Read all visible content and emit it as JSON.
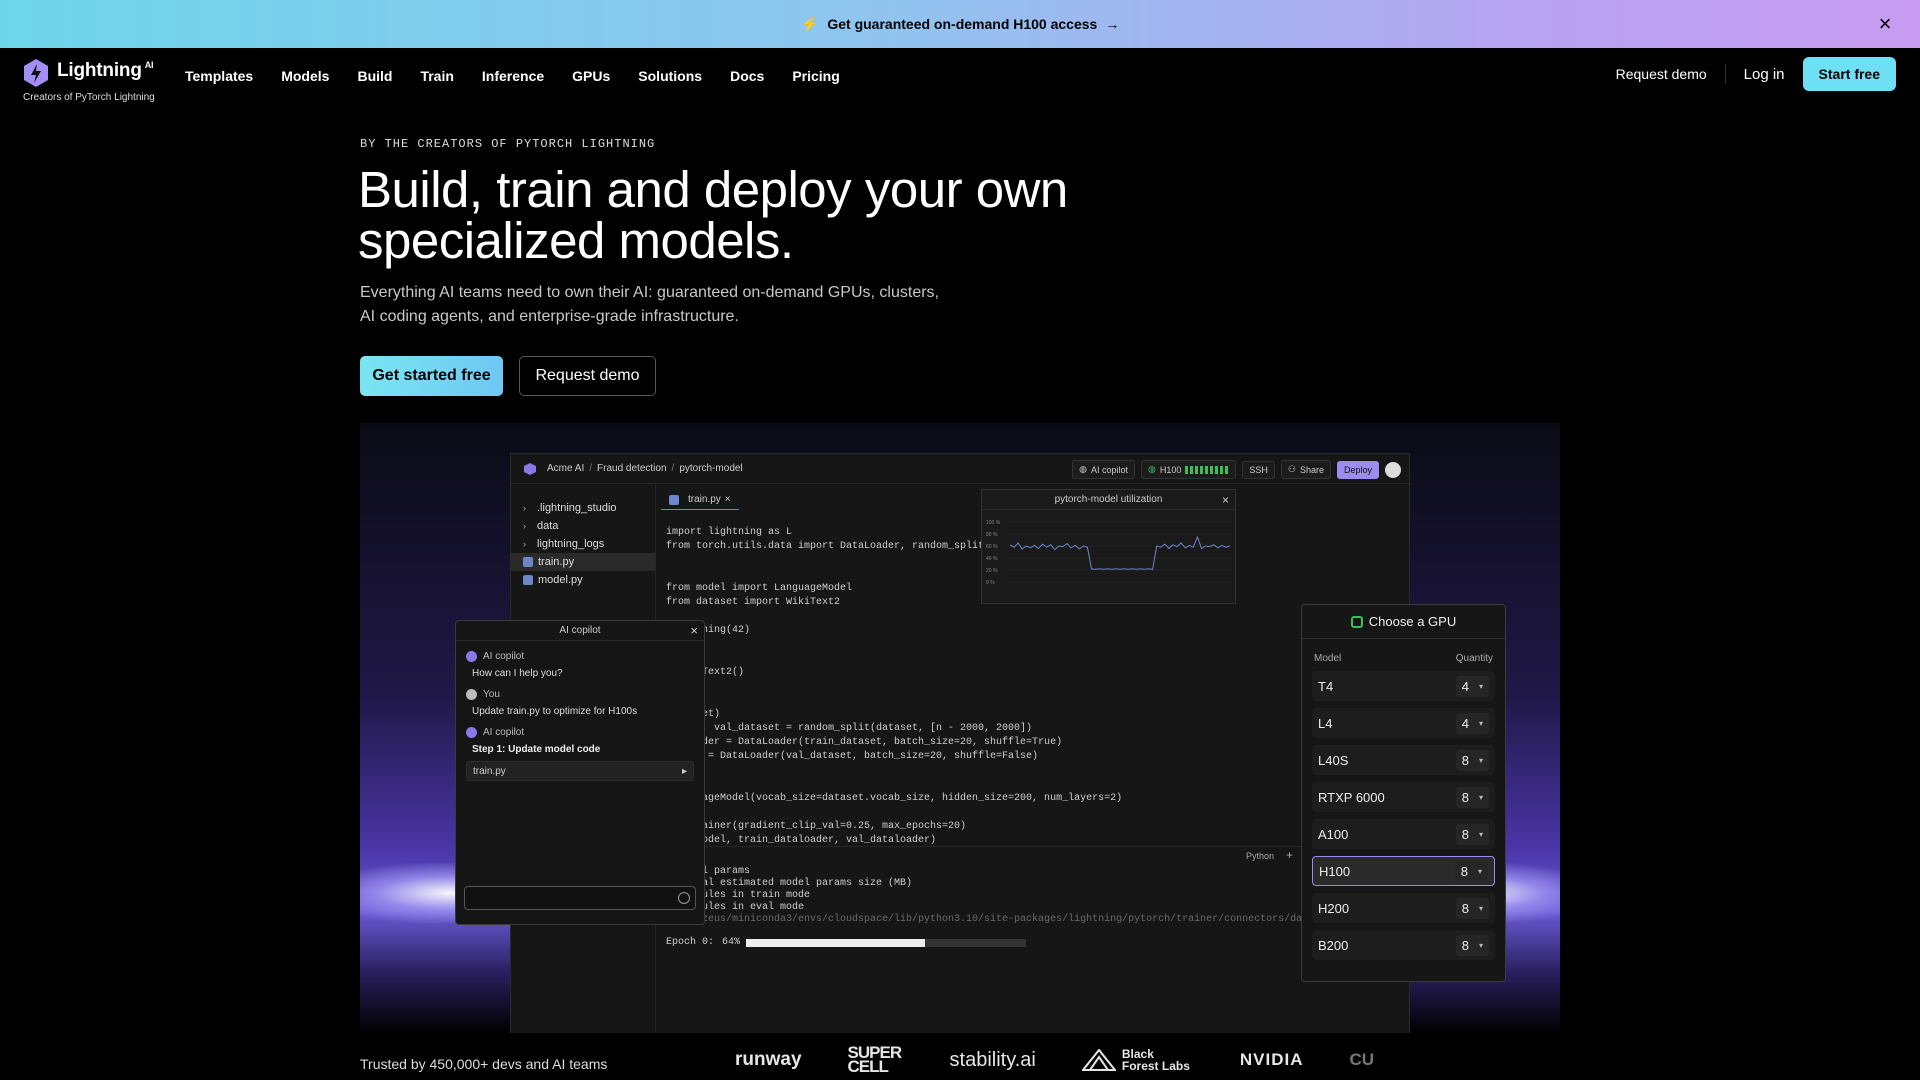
{
  "banner": {
    "text": "Get guaranteed on-demand H100 access",
    "arrow": "→",
    "bolt": "lightning-bolt-icon"
  },
  "nav": {
    "brand": "Lightning",
    "brand_sup": "AI",
    "tagline": "Creators of PyTorch Lightning",
    "links": [
      "Templates",
      "Models",
      "Build",
      "Train",
      "Inference",
      "GPUs",
      "Solutions",
      "Docs",
      "Pricing"
    ],
    "request_demo": "Request demo",
    "login": "Log in",
    "start_free": "Start free"
  },
  "hero": {
    "eyebrow": "BY THE CREATORS OF PYTORCH LIGHTNING",
    "headline_line1": "Build, train and deploy your own",
    "headline_line2": "specialized models.",
    "sub_line1": "Everything AI teams need to own their AI: guaranteed on-demand GPUs, clusters,",
    "sub_line2": "AI coding agents, and enterprise-grade infrastructure.",
    "cta_primary": "Get started free",
    "cta_secondary": "Request demo"
  },
  "studio": {
    "breadcrumb": [
      "Acme AI",
      "Fraud detection",
      "pytorch-model"
    ],
    "tools": {
      "copilot": "AI copilot",
      "gpu": "H100",
      "ssh": "SSH",
      "share": "Share",
      "deploy": "Deploy"
    },
    "files": [
      {
        "name": ".lightning_studio",
        "folder": true
      },
      {
        "name": "data",
        "folder": true
      },
      {
        "name": "lightning_logs",
        "folder": true
      },
      {
        "name": "train.py",
        "folder": false,
        "active": true
      },
      {
        "name": "model.py",
        "folder": false
      }
    ],
    "tab": "train.py",
    "code": [
      "import lightning as L",
      "from torch.utils.data import DataLoader, random_split",
      "",
      "",
      "from model import LanguageModel",
      "from dataset import WikiText2",
      "",
      "everything(42)",
      "",
      "",
      "= WikiText2()",
      "",
      "",
      "(dataset)",
      "ataset, val_dataset = random_split(dataset, [n - 2000, 2000])",
      "ataloader = DataLoader(train_dataset, batch_size=20, shuffle=True)",
      "loader = DataLoader(val_dataset, batch_size=20, shuffle=False)",
      "",
      "",
      " LanguageModel(vocab_size=dataset.vocab_size, hidden_size=200, num_layers=2)",
      "",
      "= L.Trainer(gradient_clip_val=0.25, max_epochs=20)",
      ".fit(model, train_dataloader, val_dataloader)"
    ],
    "utilization": {
      "title": "pytorch-model utilization",
      "ticks": [
        "100 %",
        "80 %",
        "60 %",
        "40 %",
        "20 %",
        "0 %"
      ],
      "series": [
        62,
        58,
        65,
        55,
        60,
        57,
        61,
        56,
        63,
        58,
        62,
        54,
        60,
        59,
        64,
        57,
        61,
        55,
        60,
        58,
        22,
        21,
        22,
        21,
        22,
        21,
        22,
        21,
        22,
        21,
        22,
        21,
        22,
        21,
        22,
        21,
        60,
        58,
        63,
        56,
        62,
        59,
        65,
        57,
        61,
        58,
        75,
        56,
        60,
        59,
        62,
        57,
        61,
        58,
        60
      ]
    },
    "gpu_picker": {
      "title": "Choose a GPU",
      "col_model": "Model",
      "col_qty": "Quantity",
      "rows": [
        {
          "model": "T4",
          "qty": "4"
        },
        {
          "model": "L4",
          "qty": "4"
        },
        {
          "model": "L40S",
          "qty": "8"
        },
        {
          "model": "RTXP 6000",
          "qty": "8"
        },
        {
          "model": "A100",
          "qty": "8"
        },
        {
          "model": "H100",
          "qty": "8",
          "selected": true
        },
        {
          "model": "H200",
          "qty": "8"
        },
        {
          "model": "B200",
          "qty": "8"
        }
      ]
    },
    "terminal": {
      "lang": "Python",
      "lines": [
        "  Total params",
        "   Total estimated model params size (MB)",
        "   Modules in train mode",
        "   Modules in eval mode"
      ],
      "path": "/home/zeus/miniconda3/envs/cloudspace/lib/python3.10/site-packages/lightning/pytorch/trainer/connectors/data_conne",
      "epoch_label": "Epoch 0:",
      "epoch_pct": "64%",
      "progress": 0.64
    },
    "copilot": {
      "title": "AI copilot",
      "messages": [
        {
          "who": "AI copilot",
          "text": "How can I help you?",
          "bold": false
        },
        {
          "who": "You",
          "text": "Update train.py to optimize for H100s",
          "bold": false
        },
        {
          "who": "AI copilot",
          "text": "Step 1: Update model code",
          "bold": true
        }
      ],
      "file_chip": "train.py"
    }
  },
  "trusted": {
    "text": "Trusted by 450,000+ devs and AI teams",
    "logos": [
      "runway",
      "SUPER CELL",
      "stability.ai",
      "Black Forest Labs",
      "NVIDIA",
      "CU"
    ]
  }
}
